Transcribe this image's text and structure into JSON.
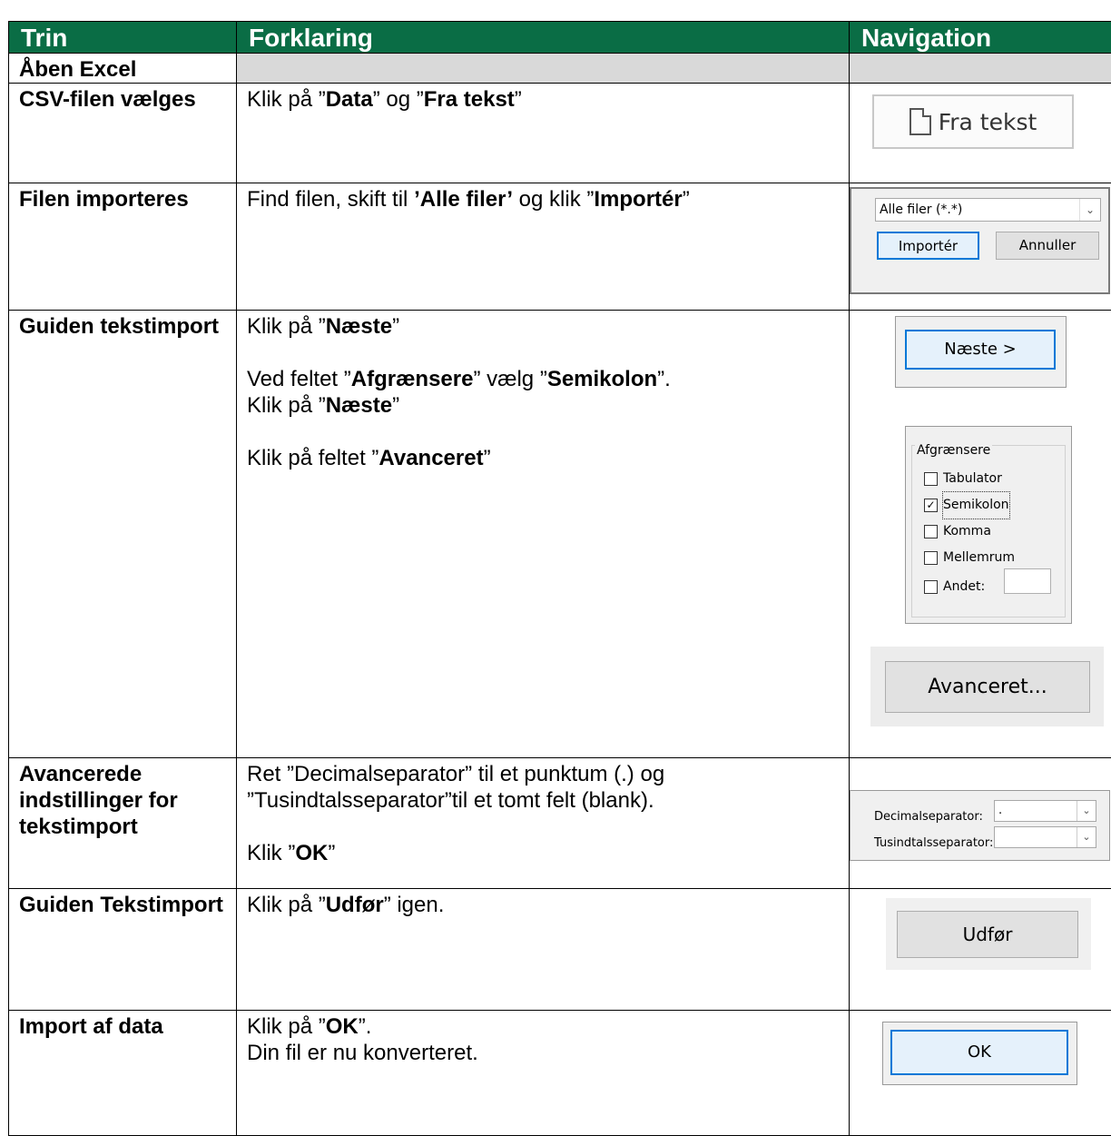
{
  "header": {
    "col1": "Trin",
    "col2": "Forklaring",
    "col3": "Navigation"
  },
  "colors": {
    "header_bg": "#0a6d45",
    "header_text": "#ffffff",
    "grey_row": "#d9d9d9",
    "focus_blue": "#0078d7"
  },
  "rows": {
    "excel": {
      "trin": "Åben Excel"
    },
    "csv": {
      "trin": "CSV-filen vælges",
      "text": [
        {
          "t": "Klik på ”",
          "b": false
        },
        {
          "t": "Data",
          "b": true
        },
        {
          "t": "” og ”",
          "b": false
        },
        {
          "t": "Fra tekst",
          "b": true
        },
        {
          "t": "”",
          "b": false
        }
      ],
      "nav_button": "Fra tekst"
    },
    "filen": {
      "trin": "Filen importeres",
      "text": [
        {
          "t": "Find filen, skift til ",
          "b": false
        },
        {
          "t": "’Alle filer’",
          "b": true
        },
        {
          "t": " og klik ”",
          "b": false
        },
        {
          "t": "Importér",
          "b": true
        },
        {
          "t": "”",
          "b": false
        }
      ],
      "dropdown_value": "Alle filer (*.*)",
      "import_button": "Importér",
      "cancel_button": "Annuller"
    },
    "guiden": {
      "trin": "Guiden tekstimport",
      "line1": [
        {
          "t": "Klik på ”",
          "b": false
        },
        {
          "t": "Næste",
          "b": true
        },
        {
          "t": "”",
          "b": false
        }
      ],
      "line2": [
        {
          "t": "Ved feltet ”",
          "b": false
        },
        {
          "t": "Afgrænsere",
          "b": true
        },
        {
          "t": "” vælg ”",
          "b": false
        },
        {
          "t": "Semikolon",
          "b": true
        },
        {
          "t": "”.",
          "b": false
        }
      ],
      "line3": [
        {
          "t": "Klik på ”",
          "b": false
        },
        {
          "t": "Næste",
          "b": true
        },
        {
          "t": "”",
          "b": false
        }
      ],
      "line4": [
        {
          "t": "Klik på feltet ”",
          "b": false
        },
        {
          "t": "Avanceret",
          "b": true
        },
        {
          "t": "”",
          "b": false
        }
      ],
      "next_button": "Næste >",
      "group_title": "Afgrænsere",
      "checkboxes": [
        {
          "label": "Tabulator",
          "checked": false
        },
        {
          "label": "Semikolon",
          "checked": true
        },
        {
          "label": "Komma",
          "checked": false
        },
        {
          "label": "Mellemrum",
          "checked": false
        },
        {
          "label": "Andet:",
          "checked": false
        }
      ],
      "advanced_button": "Avanceret..."
    },
    "avanc": {
      "trin": "Avancerede indstillinger for tekstimport",
      "line1": "Ret ”Decimalseparator” til et punktum (.) og ”Tusindtalsseparator”til et tomt felt (blank).",
      "line2": [
        {
          "t": "Klik ”",
          "b": false
        },
        {
          "t": "OK",
          "b": true
        },
        {
          "t": "”",
          "b": false
        }
      ],
      "decimal_label": "Decimalseparator:",
      "decimal_value": ".",
      "thousand_label": "Tusindtalsseparator:",
      "thousand_value": ""
    },
    "guiden2": {
      "trin": "Guiden Tekstimport",
      "text": [
        {
          "t": "Klik på ”",
          "b": false
        },
        {
          "t": "Udfør",
          "b": true
        },
        {
          "t": "” igen.",
          "b": false
        }
      ],
      "finish_button": "Udfør"
    },
    "import": {
      "trin": "Import af data",
      "text": [
        {
          "t": "Klik på ”",
          "b": false
        },
        {
          "t": "OK",
          "b": true
        },
        {
          "t": "”.",
          "b": false
        }
      ],
      "line2": "Din fil er nu konverteret.",
      "ok_button": "OK"
    }
  }
}
